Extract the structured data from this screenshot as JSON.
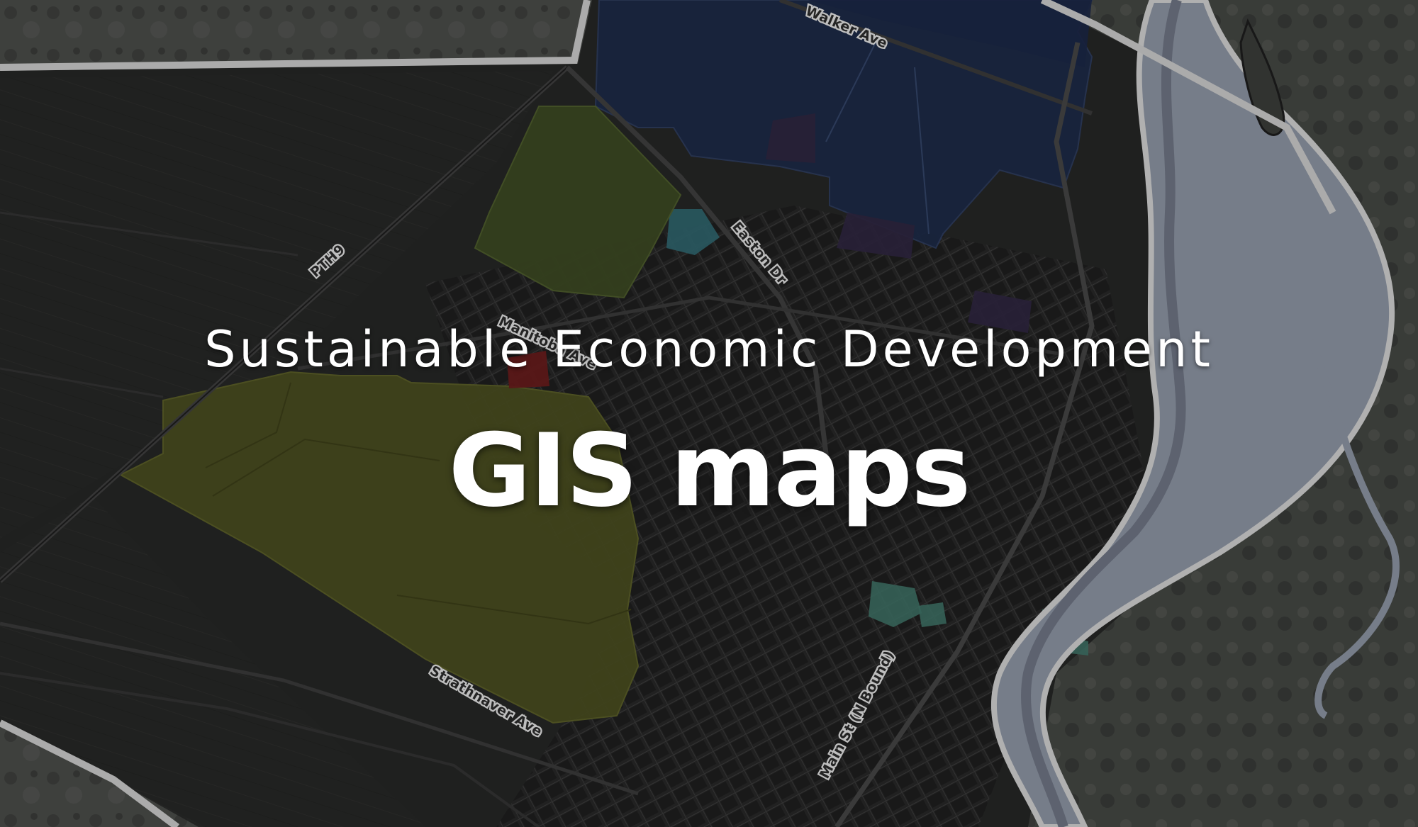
{
  "hero": {
    "subtitle": "Sustainable Economic Development",
    "title": "GIS maps"
  },
  "map": {
    "road_labels": [
      "Walker Ave",
      "PTH9",
      "Easton Dr",
      "Manitoba Ave",
      "Strathnaver Ave",
      "Main St (N Bound)"
    ],
    "zone_colors": {
      "industrial_blue": "#1c2a48",
      "agricultural_olive": "#4b4f1f",
      "park_green": "#3d4a22",
      "residential_teal": "#3f7468",
      "institutional_purple": "#2e2540",
      "commercial_red": "#6a1a1a",
      "water_cyan": "#2f6670",
      "river": "#8e96a5",
      "boundary_line": "#cfcfcf"
    }
  }
}
